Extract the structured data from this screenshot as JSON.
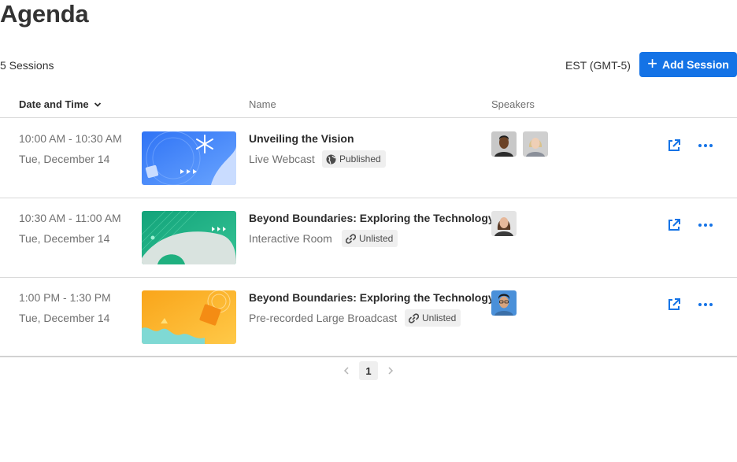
{
  "page": {
    "title": "Agenda"
  },
  "toolbar": {
    "session_count": "5 Sessions",
    "timezone": "EST (GMT-5)",
    "add_label": "Add Session"
  },
  "table": {
    "headers": {
      "date": "Date and Time",
      "name": "Name",
      "speakers": "Speakers"
    },
    "rows": [
      {
        "time": "10:00 AM - 10:30 AM",
        "date": "Tue, December 14",
        "name": "Unveiling the Vision",
        "type": "Live Webcast",
        "status": "Published",
        "status_icon": "globe-icon",
        "speaker_count": 2
      },
      {
        "time": "10:30 AM - 11:00 AM",
        "date": "Tue, December 14",
        "name": "Beyond Boundaries: Exploring the Technology",
        "type": "Interactive Room",
        "status": "Unlisted",
        "status_icon": "link-icon",
        "speaker_count": 1
      },
      {
        "time": "1:00 PM - 1:30 PM",
        "date": "Tue, December 14",
        "name": "Beyond Boundaries: Exploring the Technology",
        "type": "Pre-recorded Large Broadcast",
        "status": "Unlisted",
        "status_icon": "link-icon",
        "speaker_count": 1
      }
    ]
  },
  "pagination": {
    "current_page": "1"
  },
  "colors": {
    "accent": "#1473e6",
    "text_muted": "#707070",
    "divider": "#d9d9d9"
  }
}
